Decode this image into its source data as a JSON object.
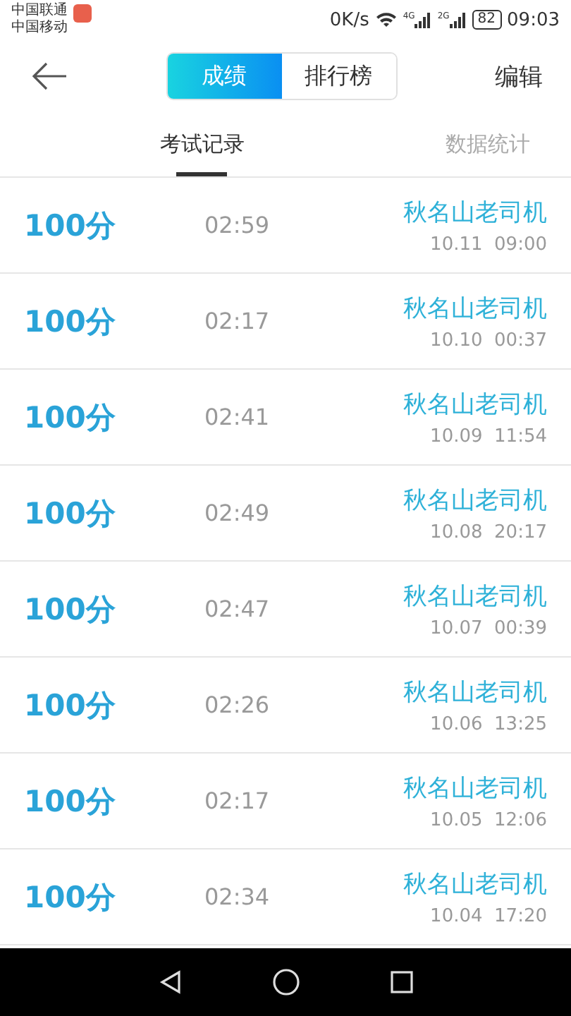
{
  "status_bar": {
    "carriers": [
      "中国联通",
      "中国移动"
    ],
    "speed": "0K/s",
    "networks": [
      "4G",
      "2G"
    ],
    "battery": "82",
    "time": "09:03"
  },
  "header": {
    "segments": [
      {
        "label": "成绩",
        "selected": true
      },
      {
        "label": "排行榜",
        "selected": false
      }
    ],
    "action": "编辑"
  },
  "tabs": [
    {
      "label": "考试记录",
      "selected": true
    },
    {
      "label": "数据统计",
      "selected": false
    }
  ],
  "records": [
    {
      "score": "100分",
      "duration": "02:59",
      "name": "秋名山老司机",
      "date": "10.11  09:00"
    },
    {
      "score": "100分",
      "duration": "02:17",
      "name": "秋名山老司机",
      "date": "10.10  00:37"
    },
    {
      "score": "100分",
      "duration": "02:41",
      "name": "秋名山老司机",
      "date": "10.09  11:54"
    },
    {
      "score": "100分",
      "duration": "02:49",
      "name": "秋名山老司机",
      "date": "10.08  20:17"
    },
    {
      "score": "100分",
      "duration": "02:47",
      "name": "秋名山老司机",
      "date": "10.07  00:39"
    },
    {
      "score": "100分",
      "duration": "02:26",
      "name": "秋名山老司机",
      "date": "10.06  13:25"
    },
    {
      "score": "100分",
      "duration": "02:17",
      "name": "秋名山老司机",
      "date": "10.05  12:06"
    },
    {
      "score": "100分",
      "duration": "02:34",
      "name": "秋名山老司机",
      "date": "10.04  17:20"
    }
  ]
}
